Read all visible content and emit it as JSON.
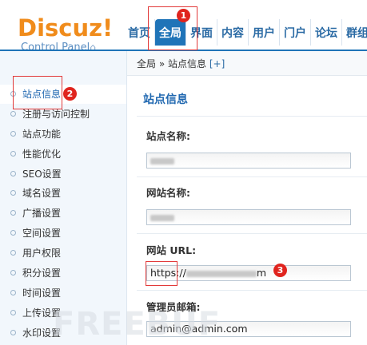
{
  "logo": {
    "text": "Discuz!",
    "subtitle": "Control Panel",
    "home_icon": "⌂"
  },
  "nav": {
    "items": [
      {
        "label": "首页",
        "active": false
      },
      {
        "label": "全局",
        "active": true
      },
      {
        "label": "界面",
        "active": false
      },
      {
        "label": "内容",
        "active": false
      },
      {
        "label": "用户",
        "active": false
      },
      {
        "label": "门户",
        "active": false
      },
      {
        "label": "论坛",
        "active": false
      },
      {
        "label": "群组",
        "active": false
      }
    ]
  },
  "breadcrumb": {
    "section": "全局",
    "separator": "»",
    "page": "站点信息",
    "add": "[+]"
  },
  "sidebar": {
    "items": [
      {
        "label": "站点信息",
        "active": true
      },
      {
        "label": "注册与访问控制"
      },
      {
        "label": "站点功能"
      },
      {
        "label": "性能优化"
      },
      {
        "label": "SEO设置"
      },
      {
        "label": "域名设置"
      },
      {
        "label": "广播设置"
      },
      {
        "label": "空间设置"
      },
      {
        "label": "用户权限"
      },
      {
        "label": "积分设置"
      },
      {
        "label": "时间设置"
      },
      {
        "label": "上传设置"
      },
      {
        "label": "水印设置"
      }
    ]
  },
  "main": {
    "title": "站点信息",
    "fields": [
      {
        "label": "站点名称:",
        "value": ""
      },
      {
        "label": "网站名称:",
        "value": ""
      },
      {
        "label": "网站 URL:",
        "value_prefix": "https://",
        "value_suffix": "m"
      },
      {
        "label": "管理员邮箱:",
        "value": "admin@admin.com"
      }
    ]
  },
  "annotations": [
    "1",
    "2",
    "3"
  ],
  "watermark": "FREEBUF",
  "colors": {
    "accent": "#1f74b8",
    "logo": "#f08c1c",
    "annotation": "#e0241e"
  }
}
